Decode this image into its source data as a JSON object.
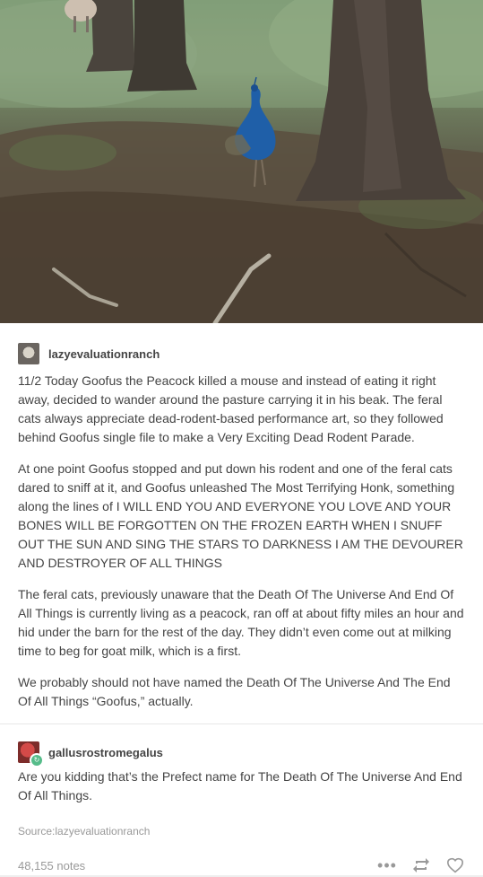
{
  "post": {
    "author1": "lazyevaluationranch",
    "paragraphs": [
      "11/2 Today Goofus the Peacock killed a mouse and instead of eating it right away, decided to wander around the pasture carrying it in his beak. The feral cats always appreciate dead-rodent-based performance art, so they followed behind Goofus single file to make a Very Exciting Dead Rodent Parade.",
      "At one point Goofus stopped and put down his rodent and one of the feral cats dared to sniff at it, and Goofus unleashed The Most Terrifying Honk, something along the lines of I WILL END YOU AND EVERYONE YOU LOVE AND YOUR BONES WILL BE FORGOTTEN ON THE FROZEN EARTH WHEN I SNUFF OUT THE SUN AND SING THE STARS TO DARKNESS I AM THE DEVOURER AND DESTROYER OF ALL THINGS",
      "The feral cats, previously unaware that the Death Of The Universe And End Of All Things is currently living as a peacock, ran off at about fifty miles an hour and hid under the barn for the rest of the day. They didn’t even come out at milking time to beg for goat milk, which is a first.",
      "We probably should not have named the Death Of The Universe And The End Of All Things “Goofus,” actually."
    ],
    "author2": "gallusrostromegalus",
    "reply": "Are you kidding that’s the Prefect name for The Death Of The Universe And End Of All Things.",
    "source": "Source:lazyevaluationranch",
    "notes": "48,155 notes"
  },
  "icons": {
    "more": "ellipsis-icon",
    "reblog": "reblog-icon",
    "like": "heart-icon"
  }
}
